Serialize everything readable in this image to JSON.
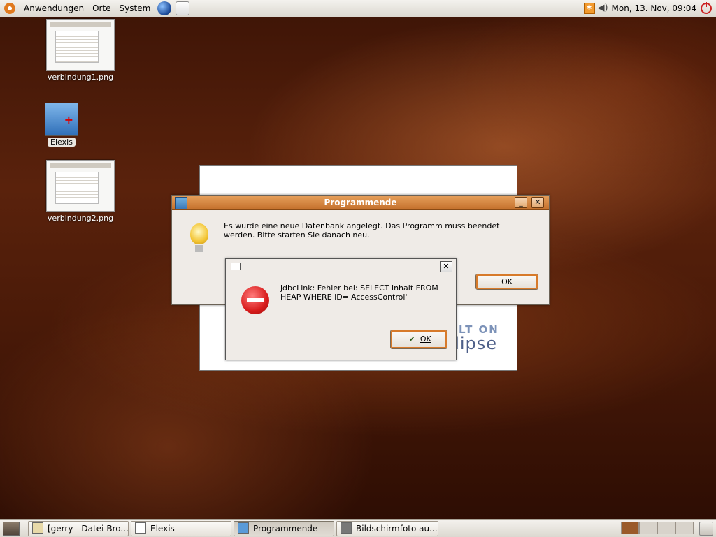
{
  "top_panel": {
    "menus": [
      "Anwendungen",
      "Orte",
      "System"
    ],
    "clock": "Mon, 13. Nov, 09:04"
  },
  "desktop": {
    "icons": [
      {
        "label": "verbindung1.png"
      },
      {
        "label": "Elexis"
      },
      {
        "label": "verbindung2.png"
      }
    ]
  },
  "splash": {
    "built_on": "LT ON",
    "logo": "clipse"
  },
  "dialog_main": {
    "title": "Programmende",
    "message": "Es wurde eine neue Datenbank angelegt. Das Programm muss beendet werden. Bitte starten Sie danach neu.",
    "ok_label": "OK",
    "minimize_glyph": "_",
    "close_glyph": "✕"
  },
  "dialog_error": {
    "message": "jdbcLink: Fehler bei: SELECT inhalt FROM HEAP WHERE ID='AccessControl'",
    "ok_label": "OK",
    "close_glyph": "✕"
  },
  "taskbar": {
    "items": [
      {
        "label": "[gerry - Datei-Bro..."
      },
      {
        "label": "Elexis"
      },
      {
        "label": "Programmende"
      },
      {
        "label": "Bildschirmfoto au..."
      }
    ]
  },
  "colors": {
    "titlebar": "#d98a45",
    "focus_ring": "#d77a2a",
    "error_red": "#d81c1c"
  }
}
